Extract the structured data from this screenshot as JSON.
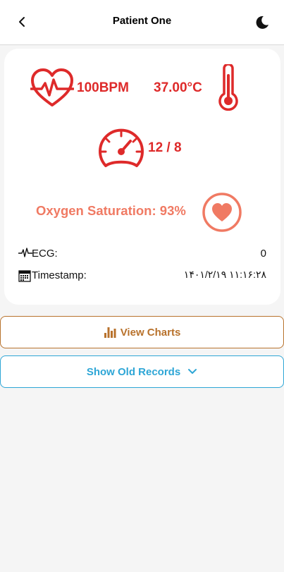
{
  "header": {
    "title": "Patient One",
    "back_icon": "chevron-left-icon",
    "theme_icon": "moon-icon"
  },
  "vitals": {
    "heart_rate": "100BPM",
    "temperature": "37.00°C",
    "blood_pressure": "12 / 8",
    "oxygen_saturation": "Oxygen Saturation: 93%"
  },
  "info": {
    "ecg_label": "ECG:",
    "ecg_value": "0",
    "timestamp_label": "Timestamp:",
    "timestamp_value": "۱۴۰۱/۲/۱۹ ۱۱:۱۶:۲۸"
  },
  "buttons": {
    "view_charts": "View Charts",
    "show_old_records": "Show Old Records"
  },
  "colors": {
    "vital_red": "#de2a2a",
    "oxygen": "#f07a63",
    "charts_button": "#b8722c",
    "records_button": "#2ea6d6"
  }
}
